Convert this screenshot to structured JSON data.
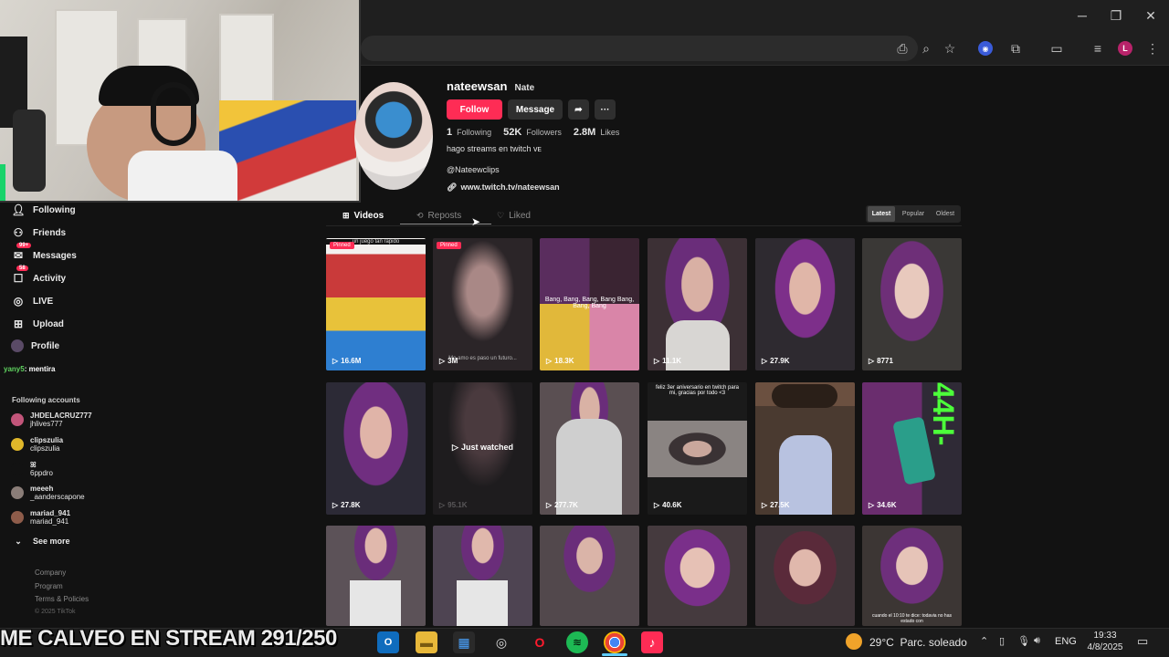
{
  "colors": {
    "accent": "#fe2c55",
    "bg": "#121212",
    "taskbar": "#1b1b1b"
  },
  "browser": {
    "window_buttons": {
      "minimize": "─",
      "maximize": "❐",
      "close": "✕"
    },
    "toolbar_icons": [
      "install-icon",
      "zoom-icon",
      "star-icon",
      "extension-icon",
      "puzzle-icon",
      "cast-icon",
      "media-icon"
    ],
    "profile_letter": "L"
  },
  "sidebar": {
    "nav": [
      {
        "label": "Following",
        "icon": "person-icon"
      },
      {
        "label": "Friends",
        "icon": "friends-icon"
      },
      {
        "label": "Messages",
        "icon": "message-icon",
        "badge": "99+"
      },
      {
        "label": "Activity",
        "icon": "activity-icon",
        "badge": "58"
      },
      {
        "label": "LIVE",
        "icon": "live-icon"
      },
      {
        "label": "Upload",
        "icon": "upload-icon"
      },
      {
        "label": "Profile",
        "icon": "profile-icon"
      }
    ],
    "chat": {
      "user": "yany5",
      "message": ": mentira"
    },
    "following_accounts_title": "Following accounts",
    "accounts": [
      {
        "name": "JHDELACRUZ777",
        "handle": "jhlives777",
        "color": "#c2557a"
      },
      {
        "name": "clipszulia",
        "handle": "clipszulia",
        "color": "#e0b72a"
      },
      {
        "name": "ꕤ",
        "handle": "6ppdro",
        "color": "#121212"
      },
      {
        "name": "meeeh",
        "handle": "_aanderscapone",
        "color": "#8a7d78"
      },
      {
        "name": "mariad_941",
        "handle": "mariad_941",
        "color": "#8e5c4a"
      }
    ],
    "see_more": "See more",
    "footer": [
      "Company",
      "Program",
      "Terms & Policies",
      "© 2025 TikTok"
    ]
  },
  "profile": {
    "username": "nateewsan",
    "nickname": "Nate",
    "follow_label": "Follow",
    "message_label": "Message",
    "stats": {
      "following_count": "1",
      "following_label": "Following",
      "followers_count": "52K",
      "followers_label": "Followers",
      "likes_count": "2.8M",
      "likes_label": "Likes"
    },
    "bio": "hago streams en twitch ᴠᴇ",
    "bio_handle": "@Nateewclips",
    "link": "www.twitch.tv/nateewsan"
  },
  "tabs": [
    {
      "label": "Videos",
      "icon": "grid-icon"
    },
    {
      "label": "Reposts",
      "icon": "repost-icon"
    },
    {
      "label": "Liked",
      "icon": "heart-lock-icon"
    }
  ],
  "sort": [
    "Latest",
    "Popular",
    "Oldest"
  ],
  "videos": [
    {
      "views": "16.6M",
      "pinned": "Pinned",
      "caption_top": "un juego tan rapido",
      "bg": "#6b3a40"
    },
    {
      "views": "3M",
      "pinned": "Pinned",
      "caption_bottom": "Me amo es paso un futuro...",
      "bg": "#3a2f33"
    },
    {
      "views": "18.3K",
      "caption_mid": "Bang, Bang, Bang, Bang Bang, Bang, Bang",
      "bg": "#4a2a44"
    },
    {
      "views": "11.1K",
      "bg": "#3c3035"
    },
    {
      "views": "27.9K",
      "bg": "#2e2a30"
    },
    {
      "views": "8771",
      "bg": "#3a3836"
    },
    {
      "views": "27.8K",
      "bg": "#2c2a36"
    },
    {
      "views": "95.1K",
      "watched": "Just watched",
      "bg": "#1e1c1e"
    },
    {
      "views": "277.7K",
      "bg": "#5a4f52"
    },
    {
      "views": "40.6K",
      "caption_top": "feliz 3er aniversario en twitch para mi, gracias por todo <3",
      "bg": "#1a1a1a"
    },
    {
      "views": "27.5K",
      "bg": "#4a3a30"
    },
    {
      "views": "34.6K",
      "caption_mid": "44H-",
      "bg": "#3b2a3c"
    },
    {
      "views": "",
      "bg": "#5c5258"
    },
    {
      "views": "",
      "bg": "#4e4452"
    },
    {
      "views": "",
      "bg": "#52484c"
    },
    {
      "views": "",
      "bg": "#453a3e"
    },
    {
      "views": "",
      "bg": "#3e3438"
    },
    {
      "views": "",
      "caption_bottom": "cuando el 10:10 te dice: todavia no has estado con",
      "bg": "#3c3634"
    }
  ],
  "stream_overlay": "ME CALVEO EN STREAM 291/250",
  "taskbar": {
    "apps": [
      "outlook-icon",
      "explorer-icon",
      "store-icon",
      "obs-icon",
      "opera-icon",
      "spotify-icon",
      "chrome-icon",
      "tiktok-icon"
    ],
    "weather": "29°C  Parc. soleado",
    "lang": "ENG",
    "time": "19:33",
    "date": "4/8/2025"
  }
}
